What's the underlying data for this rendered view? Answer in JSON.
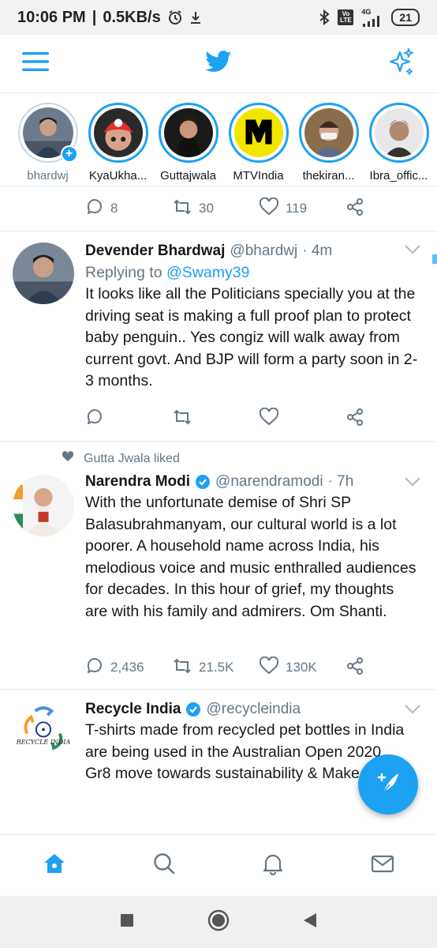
{
  "status_bar": {
    "time": "10:06 PM",
    "speed": "0.5KB/s",
    "network": "4G",
    "volte": "Vo LTE",
    "battery": "21"
  },
  "app_bar": {
    "menu_icon": "hamburger-icon",
    "logo_icon": "twitter-bird-icon",
    "sparkle_icon": "sparkle-icon"
  },
  "fleets": [
    {
      "name": "bhardwj",
      "own": true
    },
    {
      "name": "KyaUkha..."
    },
    {
      "name": "Guttajwala"
    },
    {
      "name": "MTVIndia"
    },
    {
      "name": "thekiran..."
    },
    {
      "name": "Ibra_offic..."
    }
  ],
  "top_actions": {
    "replies": "8",
    "retweets": "30",
    "likes": "119"
  },
  "tweets": [
    {
      "name": "Devender Bhardwaj",
      "handle": "@bhardwj",
      "time": "· 4m",
      "replying_prefix": "Replying to",
      "replying_to": "@Swamy39",
      "text": "It looks like all the Politicians specially you at the driving seat is making a full proof plan to protect baby penguin.. Yes congiz will walk away from current govt. And BJP will form a party soon in 2-3 months.",
      "replies": "",
      "retweets": "",
      "likes": ""
    },
    {
      "liked_by": "Gutta Jwala liked",
      "name": "Narendra Modi",
      "handle": "@narendramodi",
      "time": "· 7h",
      "text": "With the unfortunate demise of Shri SP Balasubrahmanyam, our cultural world is a lot poorer. A household name across India, his melodious voice and music enthralled audiences for decades. In this hour of grief, my thoughts are with his family and admirers. Om Shanti.",
      "replies": "2,436",
      "retweets": "21.5K",
      "likes": "130K"
    },
    {
      "name": "Recycle India",
      "handle": "@recycleindia",
      "avatar_text": "RECYCLE INDIA",
      "text_lines": [
        "T-shirts made from recycled pet bottles in India are being used in the Australian Open 2020",
        "Gr8 move towards sustainability & Make in India"
      ]
    }
  ],
  "colors": {
    "accent": "#1da1f2",
    "secondary_text": "#657786",
    "divider": "#e6ecf0"
  }
}
